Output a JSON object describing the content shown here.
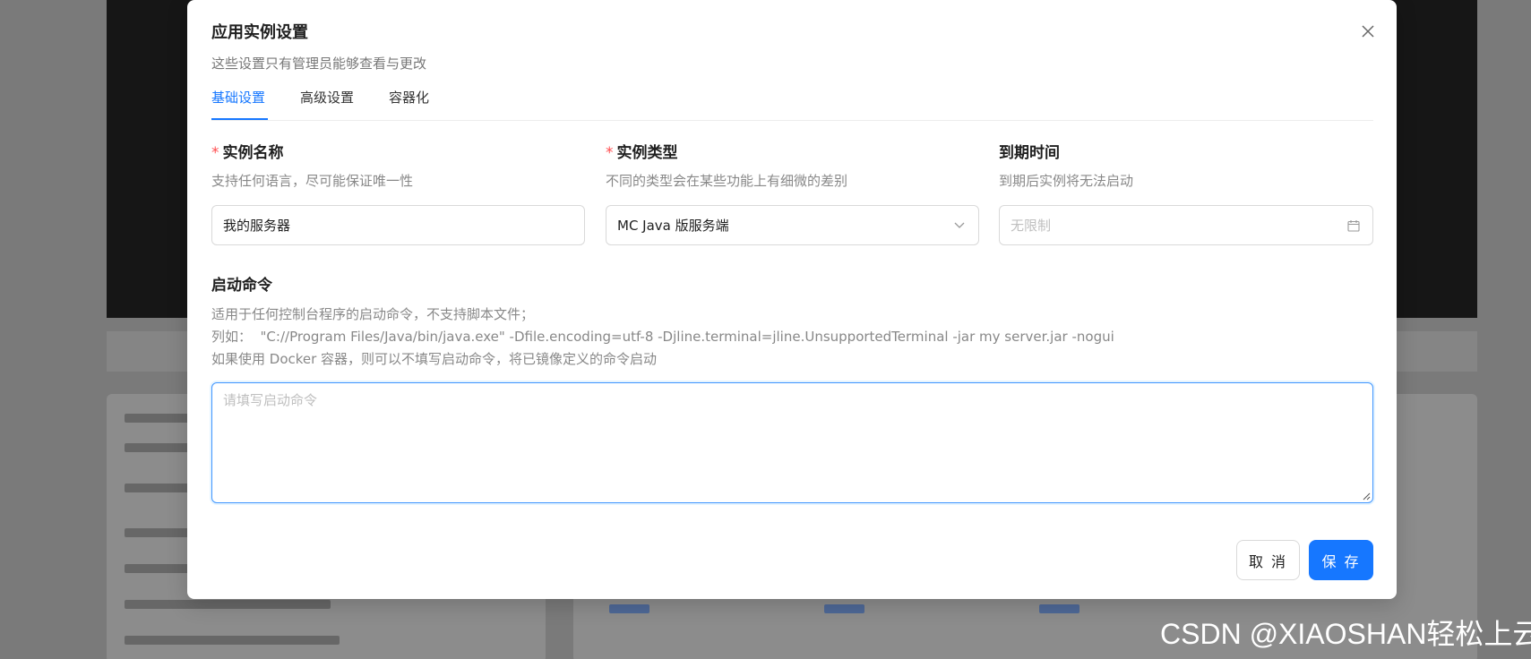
{
  "dialog": {
    "title": "应用实例设置",
    "subtitle": "这些设置只有管理员能够查看与更改",
    "close_icon": "close-icon"
  },
  "tabs": [
    {
      "label": "基础设置",
      "active": true
    },
    {
      "label": "高级设置",
      "active": false
    },
    {
      "label": "容器化",
      "active": false
    }
  ],
  "fields": {
    "name": {
      "required_mark": "*",
      "label": "实例名称",
      "help": "支持任何语言，尽可能保证唯一性",
      "value": "我的服务器"
    },
    "type": {
      "required_mark": "*",
      "label": "实例类型",
      "help": "不同的类型会在某些功能上有细微的差别",
      "value": "MC Java 版服务端",
      "icon": "chevron-down-icon"
    },
    "expire": {
      "label": "到期时间",
      "help": "到期后实例将无法启动",
      "placeholder": "无限制",
      "icon": "calendar-icon"
    },
    "command": {
      "label": "启动命令",
      "help_line1": "适用于任何控制台程序的启动命令，不支持脚本文件；",
      "help_line2": "列如：  \"C://Program Files/Java/bin/java.exe\" -Dfile.encoding=utf-8 -Djline.terminal=jline.UnsupportedTerminal -jar my server.jar -nogui",
      "help_line3": "如果使用 Docker 容器，则可以不填写启动命令，将已镜像定义的命令启动",
      "placeholder": "请填写启动命令",
      "value": ""
    }
  },
  "buttons": {
    "cancel": "取 消",
    "save": "保 存"
  },
  "watermark": "CSDN @XIAOSHAN轻松上云",
  "colors": {
    "primary": "#1677ff",
    "required": "#ff4d4f",
    "overlay": "#7a7a7a"
  }
}
